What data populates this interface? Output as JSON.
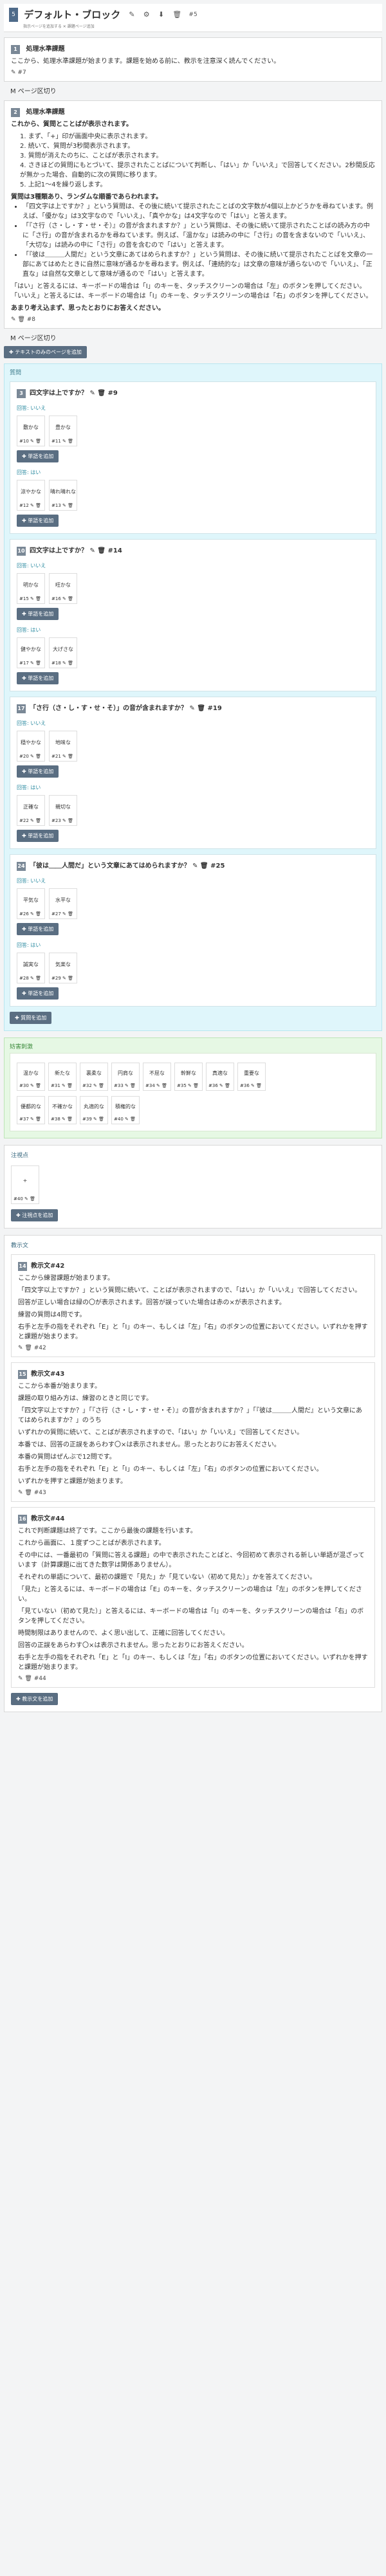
{
  "header": {
    "badge": "5",
    "title": "デフォルト・ブロック",
    "counter": "#5",
    "sub": "指示ページを追加する ✕ 課題ページ追加"
  },
  "block_intro": {
    "num": "1",
    "title": "処理水準課題",
    "text": "ここから、処理水準課題が始まります。課題を始める前に、教示を注意深く読んでください。",
    "id": "#7"
  },
  "bp_link1": "M ページ区切り",
  "block_main": {
    "num": "2",
    "title": "処理水準課題",
    "intro": "これから、質問とことばが表示されます。",
    "steps": [
      "1. まず、「+」印が画面中央に表示されます。",
      "2. 続いて、質問が3秒間表示されます。",
      "3. 質問が消えたのちに、ことばが表示されます。",
      "4. さきほどの質問にもとづいて、提示されたことばについて判断し、「はい」か「いいえ」で回答してください。2秒間反応が無かった場合、自動的に次の質問に移ります。",
      "5. 上記1〜4を繰り返します。"
    ],
    "types_title": "質問は3種類あり、ランダムな順番であらわれます。",
    "types": [
      "「四文字は上ですか？」という質問は、その後に続いて提示されたことばの文字数が4個以上かどうかを尋ねています。例えば、「優かな」は3文字なので「いいえ」、「真やかな」は4文字なので「はい」と答えます。",
      "「『さ行（さ・し・す・せ・そ）』の音が含まれますか？」という質問は、その後に続いて提示されたことばの読み方の中に「さ行」の音が含まれるかを尋ねています。例えば、「温かな」は読みの中に「さ行」の音を含まないので「いいえ」、「大切な」は読みの中に「さ行」の音を含むので「はい」と答えます。",
      "「『彼は＿＿＿人間だ』という文章にあてはめられますか？」という質問は、その後に続いて提示されたことばを文章の一部にあてはめたときに自然に意味が通るかを尋ねます。例えば、「連続的な」は文章の意味が通らないので「いいえ」、「正直な」は自然な文章として意味が通るので「はい」と答えます。"
    ],
    "answer": "「はい」と答えるには、キーボードの場合は「I」のキーを、タッチスクリーンの場合は「左」のボタンを押してください。「いいえ」と答えるには、キーボードの場合は「I」のキーを、タッチスクリーンの場合は「右」のボタンを押してください。",
    "ready": "あまり考え込まず、思ったとおりにお答えください。",
    "id": "#8"
  },
  "bp_link2": "M ページ区切り",
  "add_text_btn": "✚ テキストのみのページを追加",
  "questions_label": "質問",
  "questions": [
    {
      "num": "3",
      "text": "四文字は上ですか？",
      "id": "#9",
      "no_label": "回答: いいえ",
      "no": [
        {
          "word": "敷かな",
          "id": "#10"
        },
        {
          "word": "豊かな",
          "id": "#11"
        }
      ],
      "yes_label": "回答: はい",
      "yes": [
        {
          "word": "涼やかな",
          "id": "#12"
        },
        {
          "word": "晴れ晴れな",
          "id": "#13"
        }
      ]
    },
    {
      "num": "10",
      "text": "四文字は上ですか？",
      "id": "#14",
      "no_label": "回答: いいえ",
      "no": [
        {
          "word": "明かな",
          "id": "#15"
        },
        {
          "word": "旺かな",
          "id": "#16"
        }
      ],
      "yes_label": "回答: はい",
      "yes": [
        {
          "word": "健やかな",
          "id": "#17"
        },
        {
          "word": "大げさな",
          "id": "#18"
        }
      ]
    },
    {
      "num": "17",
      "text": "「さ行（さ・し・す・せ・そ）」の音が含まれますか？",
      "id": "#19",
      "no_label": "回答: いいえ",
      "no": [
        {
          "word": "穏やかな",
          "id": "#20"
        },
        {
          "word": "地味な",
          "id": "#21"
        }
      ],
      "yes_label": "回答: はい",
      "yes": [
        {
          "word": "正確な",
          "id": "#22"
        },
        {
          "word": "親切な",
          "id": "#23"
        }
      ]
    },
    {
      "num": "24",
      "text": "「彼は＿＿人間だ」という文章にあてはめられますか？",
      "id": "#25",
      "no_label": "回答: いいえ",
      "no": [
        {
          "word": "平気な",
          "id": "#26"
        },
        {
          "word": "水平な",
          "id": "#27"
        }
      ],
      "yes_label": "回答: はい",
      "yes": [
        {
          "word": "誠実な",
          "id": "#28"
        },
        {
          "word": "気楽な",
          "id": "#29"
        }
      ]
    }
  ],
  "add_question_btn": "✚ 質問を追加",
  "distractor_label": "妨害刺激",
  "distractors_row1": [
    {
      "word": "温かな",
      "id": "#30"
    },
    {
      "word": "新たな",
      "id": "#31"
    },
    {
      "word": "裏柔な",
      "id": "#32"
    },
    {
      "word": "円肩な",
      "id": "#33"
    },
    {
      "word": "不屈な",
      "id": "#34"
    },
    {
      "word": "幹鮮な",
      "id": "#35"
    },
    {
      "word": "真適な",
      "id": "#36"
    },
    {
      "word": "重要な",
      "id": "#36"
    }
  ],
  "distractors_row2": [
    {
      "word": "優都的な",
      "id": "#37"
    },
    {
      "word": "不確かな",
      "id": "#38"
    },
    {
      "word": "丸適的な",
      "id": "#39"
    },
    {
      "word": "積権的な",
      "id": "#40"
    }
  ],
  "fixation_label": "注視点",
  "fixation": {
    "word": "+",
    "id": "#40"
  },
  "add_fixation_btn": "✚ 注視点を追加",
  "instructions_label": "教示文",
  "instructions": [
    {
      "num": "14",
      "title": "教示文#42",
      "lines": [
        "ここから練習課題が始まります。",
        "「四文字以上ですか？」という質問に続いて、ことばが表示されますので、「はい」か「いいえ」で回答してください。",
        "回答が正しい場合は緑の〇が表示されます。回答が誤っていた場合は赤の×が表示されます。",
        "練習の質問は4問です。",
        "右手と左手の指をそれぞれ「E」と「I」のキー、もしくは「左」「右」のボタンの位置においてください。いずれかを押すと課題が始まります。"
      ],
      "id": "#42"
    },
    {
      "num": "15",
      "title": "教示文#43",
      "lines": [
        "ここから本番が始まります。",
        "課題の取り組み方は、練習のときと同じです。",
        "「四文字以上ですか？」「『さ行（さ・し・す・せ・そ）』の音が含まれますか？」「『彼は＿＿＿人間だ』という文章にあてはめられますか？」のうち",
        "いずれかの質問に続いて、ことばが表示されますので、「はい」か「いいえ」で回答してください。",
        "本番では、回答の正誤をあらわす〇×は表示されません。思ったとおりにお答えください。",
        "本番の質問はぜんぶで12問です。",
        "右手と左手の指をそれぞれ「E」と「I」のキー、もしくは「左」「右」のボタンの位置においてください。",
        "いずれかを押すと課題が始まります。"
      ],
      "id": "#43"
    },
    {
      "num": "16",
      "title": "教示文#44",
      "lines": [
        "これで判断課題は終了です。ここから最後の課題を行います。",
        "これから画面に、１度ずつことばが表示されます。",
        "その中には、一番最初の「質問に答える課題」の中で表示されたことばと、今回初めて表示される新しい単語が混ざっています（計算課題に出てきた数字は関係ありません）。",
        "それぞれの単語について、最初の課題で「見た」か「見ていない（初めて見た）」かを答えてください。",
        "「見た」と答えるには、キーボードの場合は「E」のキーを、タッチスクリーンの場合は「左」のボタンを押してください。",
        "「見ていない（初めて見た）」と答えるには、キーボードの場合は「I」のキーを、タッチスクリーンの場合は「右」のボタンを押してください。",
        "時間制限はありませんので、よく思い出して、正確に回答してください。",
        "回答の正誤をあらわす〇×は表示されません。思ったとおりにお答えください。",
        "右手と左手の指をそれぞれ「E」と「I」のキー、もしくは「左」「右」のボタンの位置においてください。いずれかを押すと課題が始まります。"
      ],
      "id": "#44"
    }
  ],
  "add_instruction_btn": "✚ 教示文を追加"
}
